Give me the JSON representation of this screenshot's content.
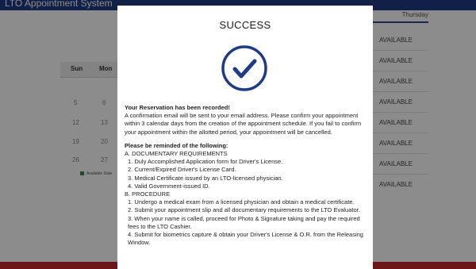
{
  "app": {
    "title": "LTO Appointment System"
  },
  "calendar": {
    "weekdays": [
      "Sun",
      "Mon"
    ],
    "rows": [
      [
        "5",
        "6"
      ],
      [
        "12",
        "13"
      ],
      [
        "19",
        "20"
      ],
      [
        "26",
        "27"
      ]
    ],
    "legend_label": "Available Date"
  },
  "schedule": {
    "day_header": "Thursday",
    "slots": [
      "AVAILABLE",
      "AVAILABLE",
      "AVAILABLE",
      "AVAILABLE",
      "AVAILABLE",
      "AVAILABLE",
      "AVAILABLE",
      "AVAILABLE"
    ]
  },
  "modal": {
    "title": "SUCCESS",
    "recorded_heading": "Your Reservation has been recorded!",
    "confirmation_text": "A confirmation email will be sent to your email address. Please confirm your appointment within 3 calendar days from the creation of the appointment schedule. If you fail to confirm your appointment within the allotted period, your appointment will be cancelled.",
    "reminder_heading": "Please be reminded of the following:",
    "section_a": "A. DOCUMENTARY REQUIREMENTS",
    "documents": [
      "1. Duly Accomplished Application form for Driver's License.",
      "2. Current/Expired Driver's License Card.",
      "3. Medical Certificate issued by an LTO-licensed physician.",
      "4. Valid Government-issued ID."
    ],
    "section_b": "B. PROCEDURE",
    "procedure": [
      "1. Undergo a medical exam from a licensed physician and obtain a medical certificate.",
      "2. Submit your appointment slip and all documentary requirements to the LTO Evaluator.",
      "3. When your name is called, proceed for Photo & Signature taking and pay the required fees to the LTO Cashier.",
      "4. Submit for biometrics capture & obtain your Driver's License & O.R. from the Releasing Window."
    ]
  },
  "colors": {
    "brand": "#1f3a86",
    "check": "#1f3a86",
    "footer": "#c32a2a",
    "legend": "#2e8b57"
  },
  "icons": {
    "success": "check-circle-icon"
  }
}
